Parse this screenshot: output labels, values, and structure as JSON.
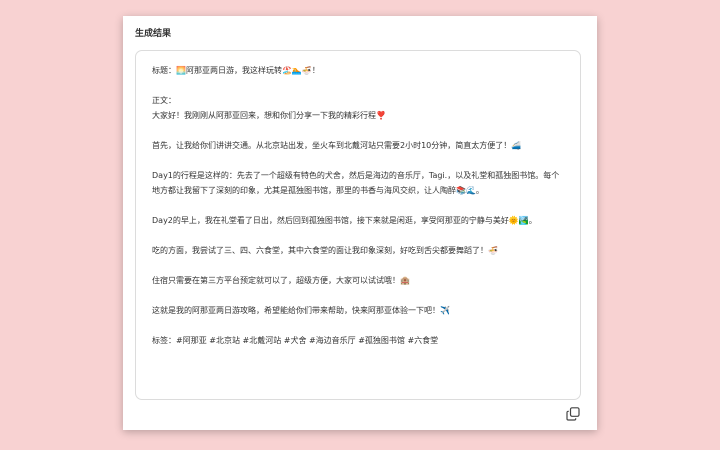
{
  "card": {
    "title": "生成结果"
  },
  "result": {
    "lines": [
      "标题：🌅阿那亚两日游，我这样玩转🏖️🏊🍜！",
      "",
      "正文：",
      "大家好！我刚刚从阿那亚回来，想和你们分享一下我的精彩行程❣️",
      "",
      "首先，让我给你们讲讲交通。从北京站出发，坐火车到北戴河站只需要2小时10分钟，简直太方便了！🚄",
      "",
      "Day1的行程是这样的：先去了一个超级有特色的犬舍，然后是海边的音乐厅，Tagi.，以及礼堂和孤独图书馆。每个地方都让我留下了深刻的印象，尤其是孤独图书馆，那里的书香与海风交织，让人陶醉📚🌊。",
      "",
      "Day2的早上，我在礼堂看了日出，然后回到孤独图书馆，接下来就是闲逛，享受阿那亚的宁静与美好🌞🏞️。",
      "",
      "吃的方面，我尝试了三、四、六食堂，其中六食堂的面让我印象深刻，好吃到舌尖都要舞蹈了！🍜",
      "",
      "住宿只需要在第三方平台预定就可以了，超级方便，大家可以试试哦！🏨",
      "",
      "这就是我的阿那亚两日游攻略，希望能给你们带来帮助，快来阿那亚体验一下吧！✈️",
      "",
      "标签：#阿那亚 #北京站 #北戴河站 #犬舍 #海边音乐厅 #孤独图书馆 #六食堂"
    ]
  },
  "icons": {
    "copy": "copy-icon"
  }
}
